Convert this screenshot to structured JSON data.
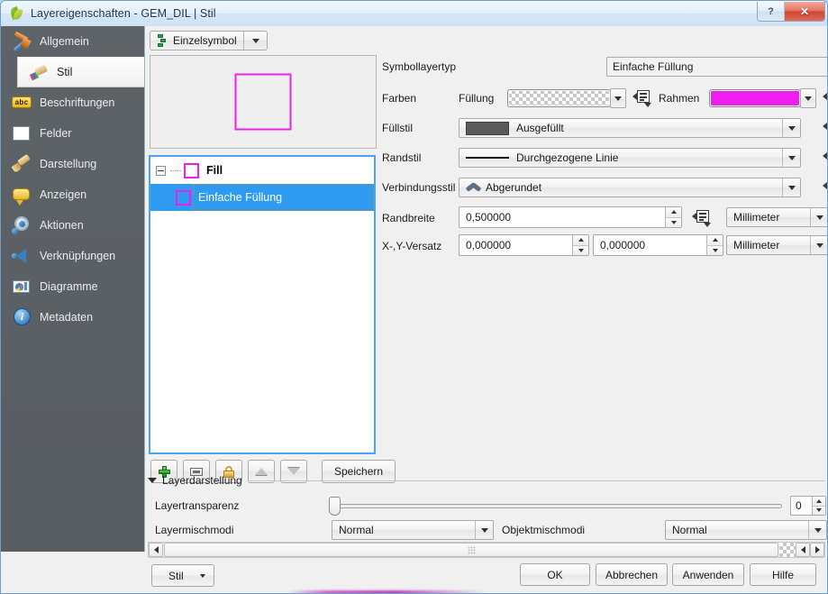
{
  "window": {
    "title": "Layereigenschaften - GEM_DIL | Stil",
    "app_icon": "qgis-leaf-icon",
    "help_button": "?",
    "close_button": "✕"
  },
  "sidebar": {
    "items": [
      {
        "label": "Allgemein",
        "icon": "hammer-wrench-icon",
        "selected": false
      },
      {
        "label": "Stil",
        "icon": "paint-brush-color-icon",
        "selected": true
      },
      {
        "label": "Beschriftungen",
        "icon": "abc-label-icon",
        "selected": false
      },
      {
        "label": "Felder",
        "icon": "table-grid-icon",
        "selected": false
      },
      {
        "label": "Darstellung",
        "icon": "paint-brush-icon",
        "selected": false
      },
      {
        "label": "Anzeigen",
        "icon": "speech-bubble-icon",
        "selected": false
      },
      {
        "label": "Aktionen",
        "icon": "gear-play-icon",
        "selected": false
      },
      {
        "label": "Verknüpfungen",
        "icon": "join-arrow-icon",
        "selected": false
      },
      {
        "label": "Diagramme",
        "icon": "pie-chart-icon",
        "selected": false
      },
      {
        "label": "Metadaten",
        "icon": "info-circle-icon",
        "selected": false
      }
    ]
  },
  "renderer": {
    "label": "Einzelsymbol",
    "icon": "single-symbol-icon"
  },
  "preview": {
    "shape": "square-outline",
    "outline_color": "#ee1fee",
    "fill_color": "transparent"
  },
  "symbol_tree": {
    "root": {
      "label": "Fill",
      "swatch_outline": "#ee1fee"
    },
    "child": {
      "label": "Einfache Füllung",
      "swatch_outline": "#ee1fee",
      "selected": true
    }
  },
  "tree_toolbar": {
    "add": "add-symbol-layer-icon",
    "remove": "remove-symbol-layer-icon",
    "lock": "lock-colors-icon",
    "move_up": "move-up-icon",
    "move_down": "move-down-icon",
    "save_label": "Speichern"
  },
  "properties": {
    "symbol_layer_type": {
      "label": "Symbollayertyp",
      "value": "Einfache Füllung"
    },
    "colors": {
      "label": "Farben",
      "fill_label": "Füllung",
      "fill_value": "transparent",
      "border_label": "Rahmen",
      "border_value": "#ee1fee",
      "override_icon": "data-defined-override-icon"
    },
    "fill_style": {
      "label": "Füllstil",
      "value": "Ausgefüllt",
      "swatch": "#5b5b5b"
    },
    "border_style": {
      "label": "Randstil",
      "value": "Durchgezogene Linie",
      "swatch": "solid-line"
    },
    "join_style": {
      "label": "Verbindungsstil",
      "value": "Abgerundet",
      "icon": "round-join-icon"
    },
    "border_width": {
      "label": "Randbreite",
      "value": "0,500000",
      "unit": "Millimeter"
    },
    "offset": {
      "label": "X-,Y-Versatz",
      "value_x": "0,000000",
      "value_y": "0,000000",
      "unit": "Millimeter"
    }
  },
  "layer_rendering": {
    "title": "Layerdarstellung",
    "expanded": true,
    "transparency": {
      "label": "Layertransparenz",
      "value": "0",
      "min": 0,
      "max": 100
    },
    "layer_blend": {
      "label": "Layermischmodi",
      "value": "Normal"
    },
    "feature_blend": {
      "label": "Objektmischmodi",
      "value": "Normal"
    }
  },
  "scrollbar": {
    "left_arrow": "scroll-left-icon",
    "right_arrow": "scroll-right-icon"
  },
  "footer": {
    "style_label": "Stil",
    "ok": "OK",
    "cancel": "Abbrechen",
    "apply": "Anwenden",
    "help": "Hilfe"
  }
}
